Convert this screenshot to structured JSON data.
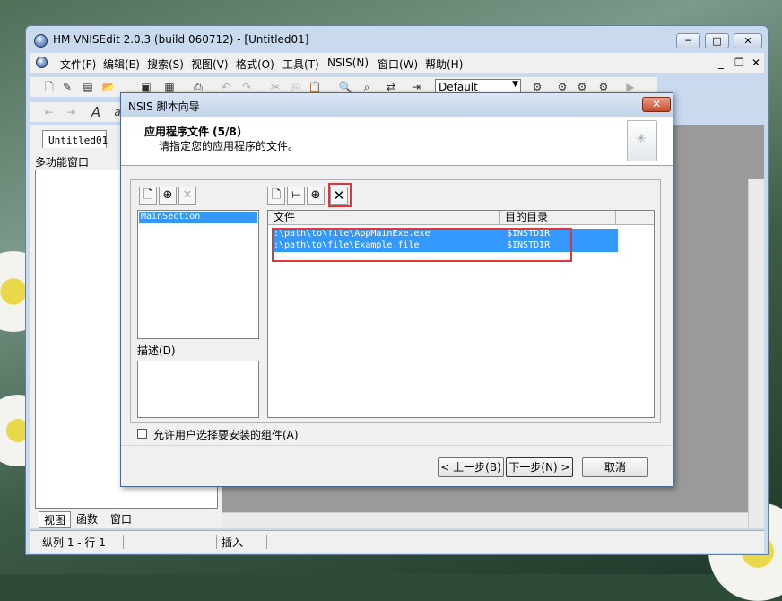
{
  "main_window": {
    "title": "HM VNISEdit 2.0.3 (build 060712) - [Untitled01]",
    "menu": [
      "文件(F)",
      "编辑(E)",
      "搜索(S)",
      "视图(V)",
      "格式(O)",
      "工具(T)",
      "NSIS(N)",
      "窗口(W)",
      "帮助(H)"
    ],
    "font_select": "Default",
    "doc_tab": "Untitled01",
    "side_panel_title": "多功能窗口",
    "side_tabs": [
      "视图",
      "函数",
      "窗口"
    ],
    "status": {
      "position": "纵列 1 - 行 1",
      "mode": "插入"
    },
    "caption_buttons": {
      "minimize": "─",
      "maximize": "□",
      "close": "✕"
    },
    "mdi_buttons": {
      "minimize": "_",
      "restore": "❐",
      "close": "✕"
    }
  },
  "dialog": {
    "title": "NSIS 脚本向导",
    "close_glyph": "✕",
    "header_title": "应用程序文件 (5/8)",
    "header_subtitle": "请指定您的应用程序的文件。",
    "sections": [
      "MainSection"
    ],
    "description_label": "描述(D)",
    "files_table": {
      "columns": [
        "文件",
        "目的目录"
      ],
      "rows": [
        {
          "file": ":\\path\\to\\file\\AppMainExe.exe",
          "dest": "$INSTDIR"
        },
        {
          "file": ":\\path\\to\\file\\Example.file",
          "dest": "$INSTDIR"
        }
      ]
    },
    "checkbox_label": "允许用户选择要安装的组件(A)",
    "checkbox_checked": false,
    "buttons": {
      "back": "< 上一步(B)",
      "next": "下一步(N) >",
      "cancel": "取消"
    },
    "icons": {
      "new": "🗋",
      "add": "⊕",
      "delete": "✕"
    }
  }
}
